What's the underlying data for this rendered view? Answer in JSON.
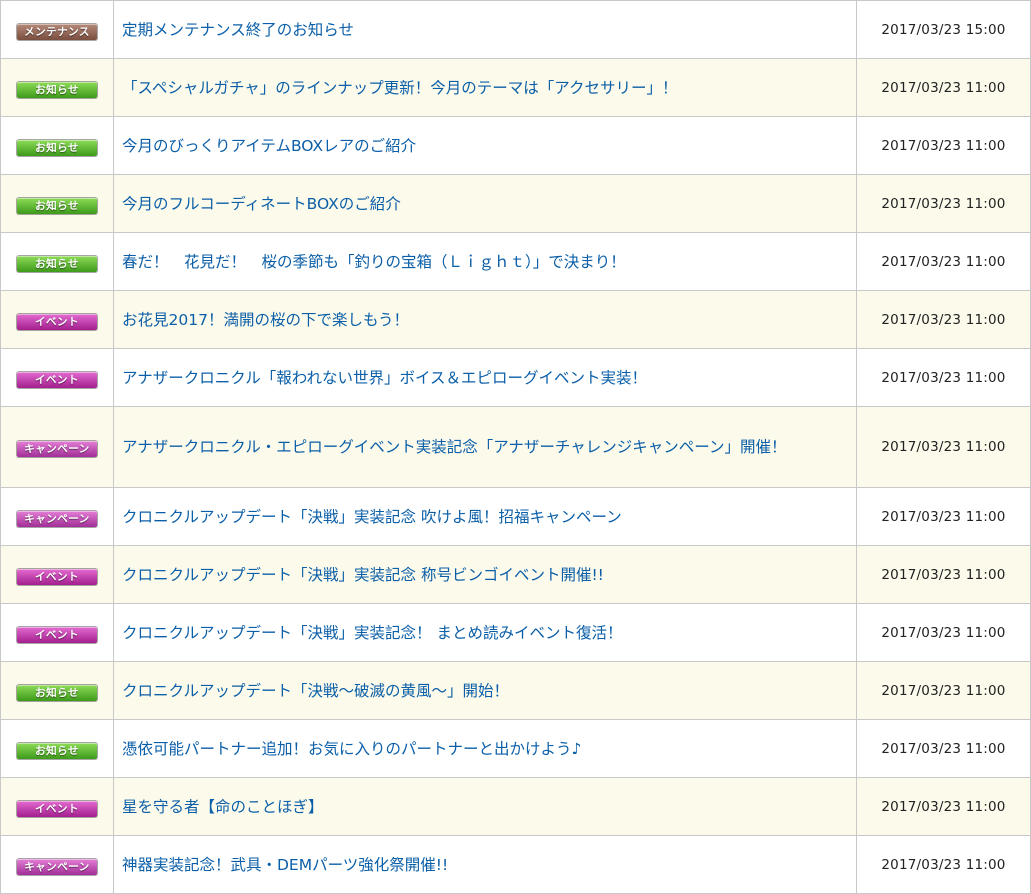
{
  "news": [
    {
      "badge": "メンテナンス",
      "badge_type": "maintenance",
      "title": "定期メンテナンス終了のお知らせ",
      "date": "2017/03/23 15:00"
    },
    {
      "badge": "お知らせ",
      "badge_type": "notice",
      "title": "「スペシャルガチャ」のラインナップ更新！今月のテーマは「アクセサリー」！",
      "date": "2017/03/23 11:00"
    },
    {
      "badge": "お知らせ",
      "badge_type": "notice",
      "title": "今月のびっくりアイテムBOXレアのご紹介",
      "date": "2017/03/23 11:00"
    },
    {
      "badge": "お知らせ",
      "badge_type": "notice",
      "title": "今月のフルコーディネートBOXのご紹介",
      "date": "2017/03/23 11:00"
    },
    {
      "badge": "お知らせ",
      "badge_type": "notice",
      "title": "春だ！　花見だ！　桜の季節も「釣りの宝箱（Ｌｉｇｈｔ）」で決まり！",
      "date": "2017/03/23 11:00"
    },
    {
      "badge": "イベント",
      "badge_type": "event",
      "title": "お花見2017！満開の桜の下で楽しもう！",
      "date": "2017/03/23 11:00"
    },
    {
      "badge": "イベント",
      "badge_type": "event",
      "title": "アナザークロニクル「報われない世界」ボイス＆エピローグイベント実装！",
      "date": "2017/03/23 11:00"
    },
    {
      "badge": "キャンペーン",
      "badge_type": "campaign",
      "title": "アナザークロニクル・エピローグイベント実装記念「アナザーチャレンジキャンペーン」開催！",
      "date": "2017/03/23 11:00"
    },
    {
      "badge": "キャンペーン",
      "badge_type": "campaign",
      "title": "クロニクルアップデート「決戦」実装記念 吹けよ風！招福キャンペーン",
      "date": "2017/03/23 11:00"
    },
    {
      "badge": "イベント",
      "badge_type": "event",
      "title": "クロニクルアップデート「決戦」実装記念 称号ビンゴイベント開催!!",
      "date": "2017/03/23 11:00"
    },
    {
      "badge": "イベント",
      "badge_type": "event",
      "title": "クロニクルアップデート「決戦」実装記念！ まとめ読みイベント復活！",
      "date": "2017/03/23 11:00"
    },
    {
      "badge": "お知らせ",
      "badge_type": "notice",
      "title": "クロニクルアップデート「決戦～破滅の黄風～」開始！",
      "date": "2017/03/23 11:00"
    },
    {
      "badge": "お知らせ",
      "badge_type": "notice",
      "title": "憑依可能パートナー追加！お気に入りのパートナーと出かけよう♪",
      "date": "2017/03/23 11:00"
    },
    {
      "badge": "イベント",
      "badge_type": "event",
      "title": "星を守る者【命のことほぎ】",
      "date": "2017/03/23 11:00"
    },
    {
      "badge": "キャンペーン",
      "badge_type": "campaign",
      "title": "神器実装記念！武具・DEMパーツ強化祭開催!!",
      "date": "2017/03/23 11:00"
    }
  ],
  "colors": {
    "link": "#0b5fa8",
    "row_alt_bg": "#fcfaeb",
    "border": "#c8c8c8",
    "maintenance": "#8b5a48",
    "notice": "#4fae24",
    "event": "#b42a9e",
    "campaign": "#b43aa6"
  }
}
